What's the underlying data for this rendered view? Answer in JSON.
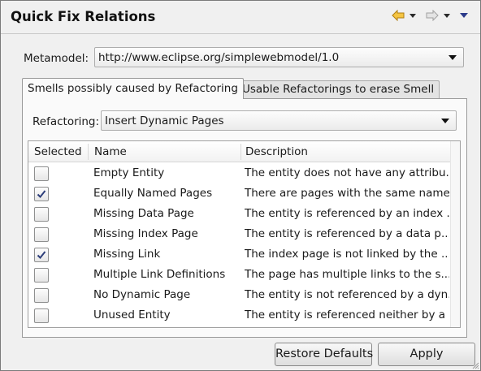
{
  "header": {
    "title": "Quick Fix Relations",
    "icons": [
      "back-arrow-icon",
      "forward-arrow-icon",
      "view-menu-icon"
    ],
    "accent": "#e8a317"
  },
  "metamodel": {
    "label": "Metamodel:",
    "value": "http://www.eclipse.org/simplewebmodel/1.0"
  },
  "tabs": [
    {
      "label": "Smells possibly caused by Refactoring",
      "active": true
    },
    {
      "label": "Usable Refactorings to erase Smell",
      "active": false
    }
  ],
  "refactoring": {
    "label": "Refactoring:",
    "value": "Insert Dynamic Pages"
  },
  "table": {
    "columns": [
      "Selected",
      "Name",
      "Description"
    ],
    "rows": [
      {
        "checked": false,
        "name": "Empty Entity",
        "description": "The entity does not have any attribu..."
      },
      {
        "checked": true,
        "name": "Equally Named Pages",
        "description": "There are pages with the same name."
      },
      {
        "checked": false,
        "name": "Missing Data Page",
        "description": "The entity is referenced by an index ..."
      },
      {
        "checked": false,
        "name": "Missing Index Page",
        "description": "The entity is referenced by a data p..."
      },
      {
        "checked": true,
        "name": "Missing Link",
        "description": "The index page is not linked by the ..."
      },
      {
        "checked": false,
        "name": "Multiple Link Definitions",
        "description": "The page has multiple links to the s..."
      },
      {
        "checked": false,
        "name": "No Dynamic Page",
        "description": "The entity is not referenced by a dyn..."
      },
      {
        "checked": false,
        "name": "Unused Entity",
        "description": "The entity is referenced neither by a ..."
      }
    ]
  },
  "buttons": {
    "restore_defaults": "Restore Defaults",
    "apply": "Apply"
  }
}
